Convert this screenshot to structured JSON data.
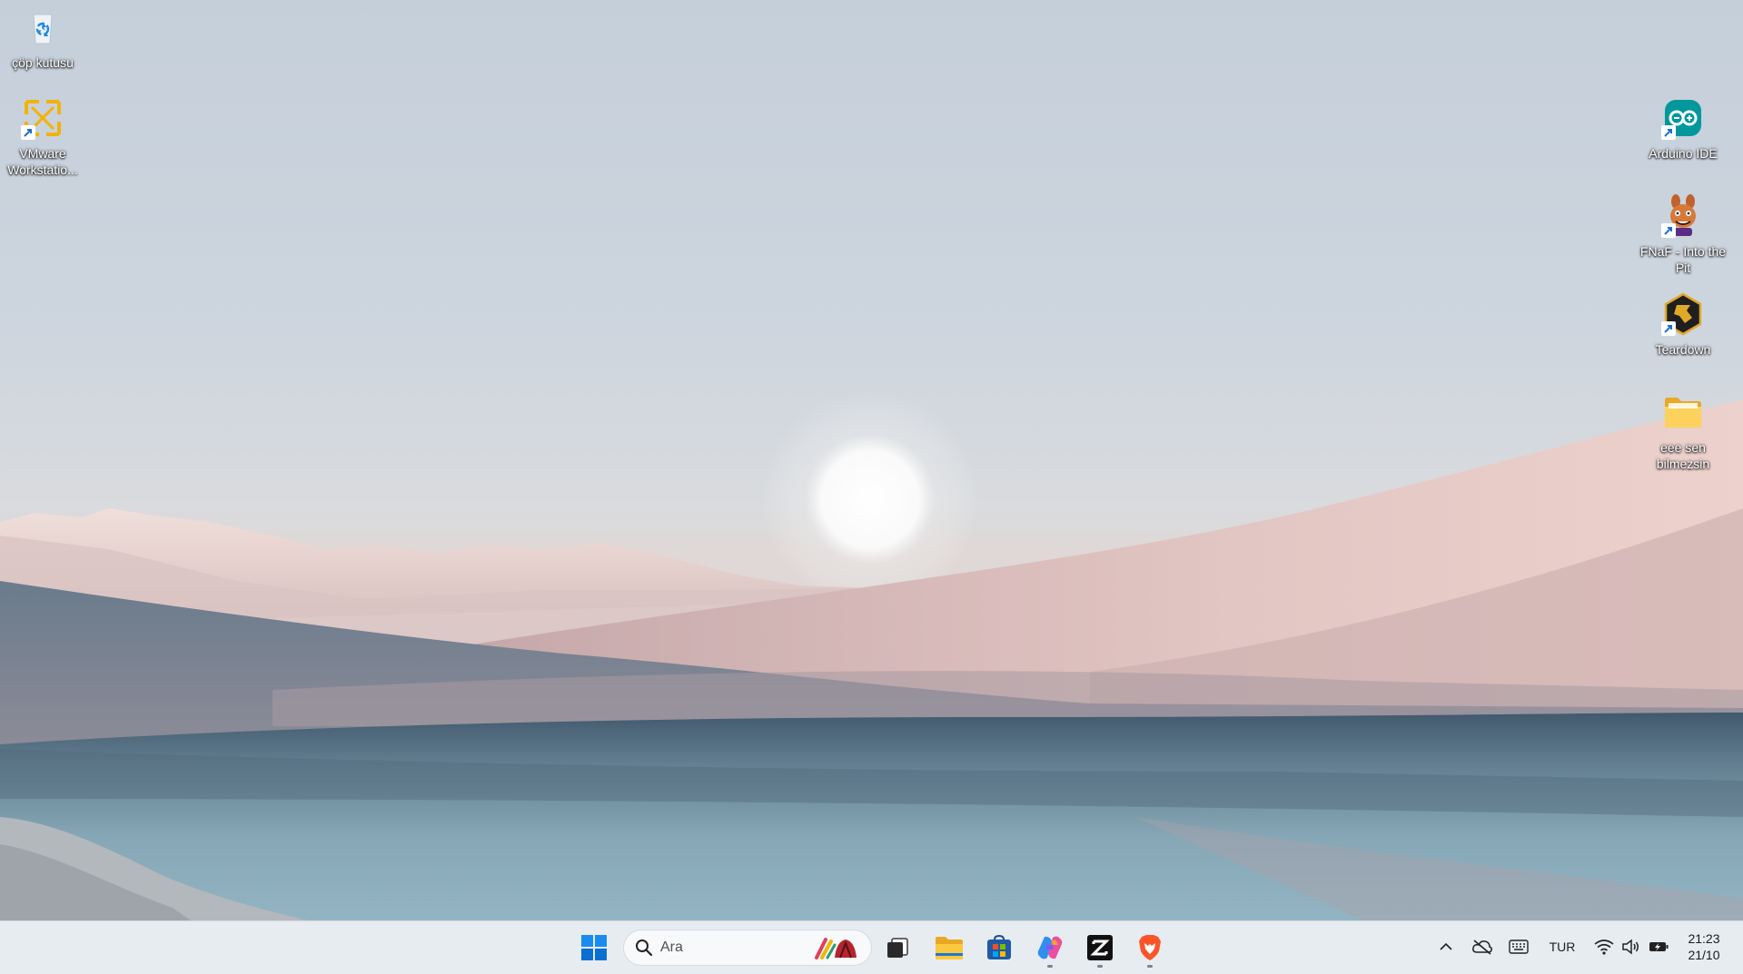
{
  "desktop": {
    "icons_left": [
      {
        "label": "çöp kutusu",
        "icon": "recycle-bin-icon"
      },
      {
        "label": "VMware Workstatio...",
        "icon": "vmware-icon"
      }
    ],
    "icons_right": [
      {
        "label": "Arduino IDE",
        "icon": "arduino-icon"
      },
      {
        "label": "FNaF - Into the Pit",
        "icon": "fnaf-icon"
      },
      {
        "label": "Teardown",
        "icon": "teardown-icon"
      },
      {
        "label": "eee sen bilmezsin",
        "icon": "folder-icon"
      }
    ]
  },
  "taskbar": {
    "search": {
      "placeholder": "Ara",
      "icon": "search-icon"
    },
    "apps": [
      {
        "name": "start",
        "icon": "windows-logo-icon",
        "running": false
      },
      {
        "name": "task-view",
        "icon": "task-view-icon",
        "running": false
      },
      {
        "name": "file-explorer",
        "icon": "folder-icon",
        "running": false
      },
      {
        "name": "microsoft-store",
        "icon": "store-icon",
        "running": false
      },
      {
        "name": "copilot",
        "icon": "copilot-icon",
        "running": true
      },
      {
        "name": "zed",
        "icon": "zed-icon",
        "running": true
      },
      {
        "name": "brave",
        "icon": "brave-lion-icon",
        "running": true
      }
    ],
    "tray": {
      "language": "TUR",
      "time": "21:23",
      "date": "21/10"
    }
  },
  "colors": {
    "taskbar_bg": "#e7ecf1",
    "windows_blue": "#0078d4",
    "folder_yellow": "#f5c242",
    "brave_orange": "#fb542b"
  }
}
